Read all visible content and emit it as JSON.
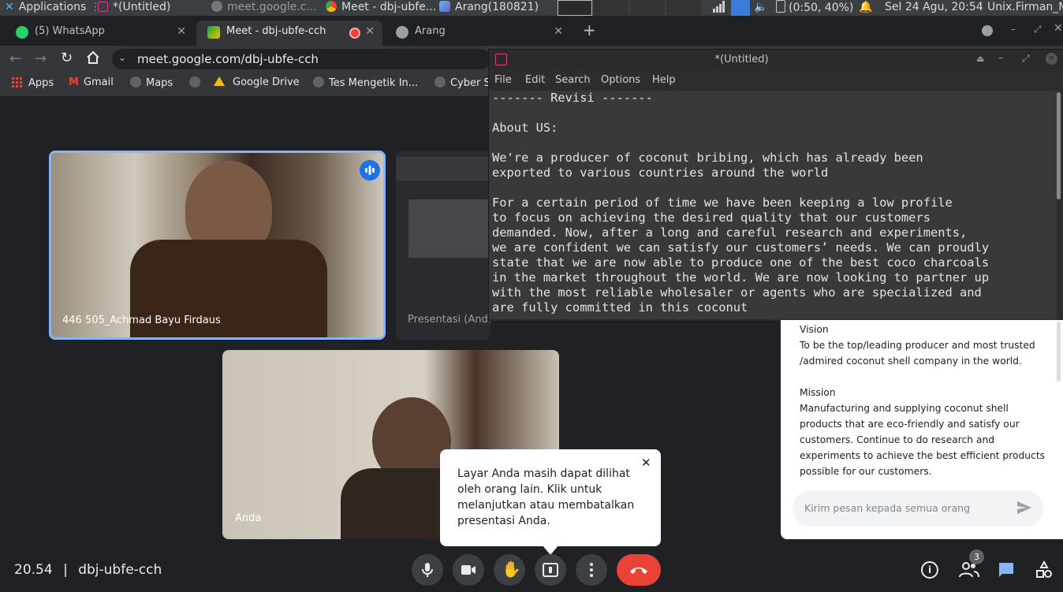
{
  "taskbar": {
    "applications": "Applications",
    "windows": [
      "*(Untitled)",
      "meet.google.c...",
      "Meet - dbj-ubfe...",
      "Arang(180821)"
    ],
    "battery": "(0:50, 40%)",
    "datetime": "Sel 24 Agu, 20:54",
    "user": "Unix.Firman_M"
  },
  "browser": {
    "tabs": [
      {
        "label": "(5) WhatsApp"
      },
      {
        "label": "Meet - dbj-ubfe-cch"
      },
      {
        "label": "Arang"
      }
    ],
    "new_tab": "+",
    "url": "meet.google.com/dbj-ubfe-cch",
    "bookmarks": [
      "Apps",
      "Gmail",
      "Maps",
      "Google Drive",
      "Tes Mengetik In...",
      "Cyber S"
    ]
  },
  "meet": {
    "participant_1": "446 505_Achmad Bayu Firdaus",
    "presentation_label": "Presentasi (Anda)",
    "self_label": "Anda",
    "meeting_time": "20.54",
    "separator": "|",
    "meeting_code": "dbj-ubfe-cch",
    "participants_count": "3",
    "tooltip": "Layar Anda masih dapat dilihat oleh orang lain. Klik untuk melanjutkan atau membatalkan presentasi Anda.",
    "chat": {
      "vision_heading": "Vision",
      "vision_text": "To be the top/leading producer and most trusted /admired coconut shell company in the world.",
      "mission_heading": "Mission",
      "mission_text": "Manufacturing and supplying coconut shell products that are eco-friendly and satisfy our customers. Continue to do research and experiments to achieve the best efficient products possible for our customers.",
      "input_placeholder": "Kirim pesan kepada semua orang"
    }
  },
  "gedit": {
    "title": "*(Untitled)",
    "menu": [
      "File",
      "Edit",
      "Search",
      "Options",
      "Help"
    ],
    "lines": [
      "------- Revisi -------",
      "",
      "About US:",
      "",
      "We're a producer of coconut bribing, which has already been",
      "exported to various countries around the world",
      "",
      "For a certain period of time we have been keeping a low profile",
      "to focus on achieving the desired quality that our customers",
      "demanded. Now, after a long and careful research and experiments,",
      "we are confident we can satisfy our customers’ needs. We can proudly",
      "state that we are now able to produce one of the best coco charcoals",
      "in the market throughout the world. We are now looking to partner up",
      "with the most reliable wholesaler or agents who are specialized and",
      "are fully committed in this coconut"
    ]
  },
  "colors": {
    "accent_blue": "#1a73e8",
    "end_call_red": "#ea4335",
    "meet_bg": "#202124"
  }
}
